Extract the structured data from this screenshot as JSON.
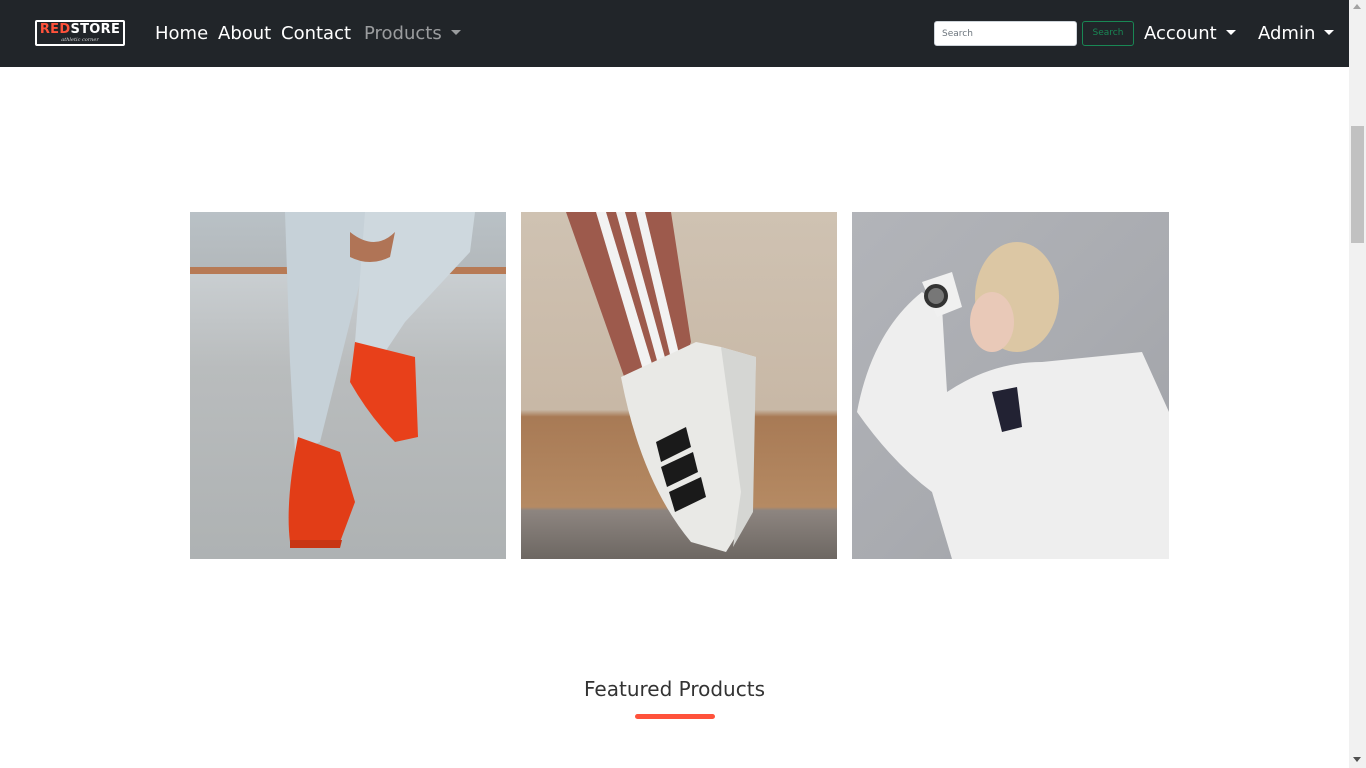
{
  "brand": {
    "logo_text_red": "RED",
    "logo_text_white": "STORE",
    "logo_tagline": "athletic corner"
  },
  "nav": {
    "home": "Home",
    "about": "About",
    "contact": "Contact",
    "products": "Products"
  },
  "search": {
    "placeholder": "Search",
    "button_label": "Search"
  },
  "account_menu": "Account",
  "admin_menu": "Admin",
  "gallery": [
    {
      "alt": "sneakers-on-wall-photo"
    },
    {
      "alt": "striped-sneaker-photo"
    },
    {
      "alt": "hoodie-woman-photo"
    }
  ],
  "featured": {
    "title": "Featured Products"
  },
  "colors": {
    "navbar_bg": "#212529",
    "accent": "#ff523b",
    "search_btn": "#198754"
  }
}
